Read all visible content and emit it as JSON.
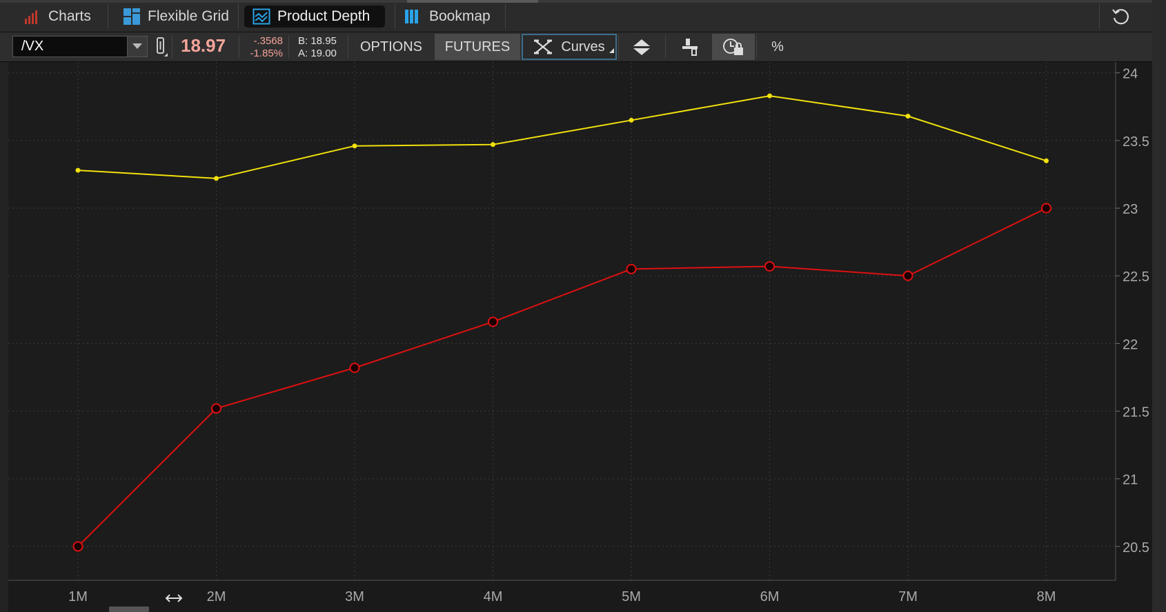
{
  "tabs": [
    {
      "label": "Charts",
      "icon": "bar-chart-icon"
    },
    {
      "label": "Flexible Grid",
      "icon": "grid-icon"
    },
    {
      "label": "Product Depth",
      "icon": "depth-chart-icon"
    },
    {
      "label": "Bookmap",
      "icon": "bookmap-icon"
    }
  ],
  "toolbar": {
    "symbol": "/VX",
    "last": "18.97",
    "net_change": "-.3568",
    "pct_change": "-1.85%",
    "bid": "B: 18.95",
    "ask": "A: 19.00",
    "options_label": "OPTIONS",
    "futures_label": "FUTURES",
    "curves_label": "Curves",
    "percent_label": "%"
  },
  "colors": {
    "series_yellow": "#f2e20c",
    "series_red": "#e01010",
    "last_price": "#f4a49a",
    "accent_blue": "#2aa3e8"
  },
  "chart_data": {
    "type": "line",
    "categories": [
      "1M",
      "2M",
      "3M",
      "4M",
      "5M",
      "6M",
      "7M",
      "8M"
    ],
    "series": [
      {
        "color": "#f2e20c",
        "marker": "dot",
        "values": [
          23.28,
          23.22,
          23.46,
          23.47,
          23.65,
          23.83,
          23.68,
          23.35
        ]
      },
      {
        "color": "#e01010",
        "marker": "circle",
        "values": [
          20.5,
          21.52,
          21.82,
          22.16,
          22.55,
          22.57,
          22.5,
          23.0
        ]
      }
    ],
    "y_ticks": [
      "20.5",
      "21",
      "21.5",
      "22",
      "22.5",
      "23",
      "23.5",
      "24"
    ],
    "ylim": [
      20.25,
      24.08
    ],
    "y_axis_side": "right",
    "grid": true
  }
}
